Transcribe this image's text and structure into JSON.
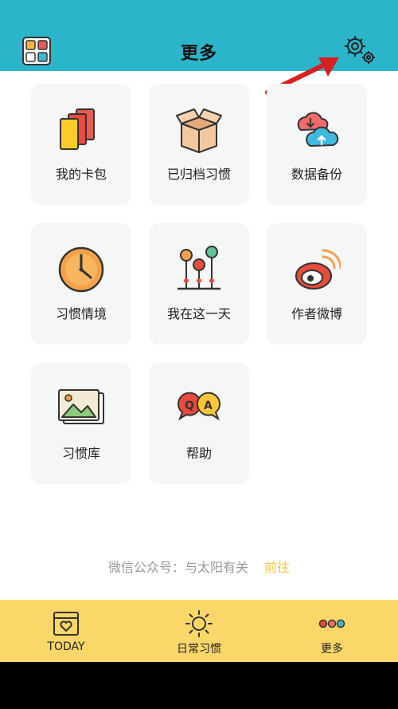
{
  "header": {
    "title": "更多"
  },
  "cards": [
    {
      "label": "我的卡包",
      "icon": "cards-icon"
    },
    {
      "label": "已归档习惯",
      "icon": "archive-box-icon"
    },
    {
      "label": "数据备份",
      "icon": "cloud-sync-icon"
    },
    {
      "label": "习惯情境",
      "icon": "clock-icon"
    },
    {
      "label": "我在这一天",
      "icon": "timeline-pins-icon"
    },
    {
      "label": "作者微博",
      "icon": "weibo-icon"
    },
    {
      "label": "习惯库",
      "icon": "picture-frame-icon"
    },
    {
      "label": "帮助",
      "icon": "qa-bubbles-icon"
    }
  ],
  "wechat": {
    "text": "微信公众号：与太阳有关",
    "action": "前往"
  },
  "bottom_nav": [
    {
      "label": "TODAY",
      "icon": "calendar-heart-icon"
    },
    {
      "label": "日常习惯",
      "icon": "sun-icon"
    },
    {
      "label": "更多",
      "icon": "three-dots-icon"
    }
  ],
  "colors": {
    "header": "#2bb5ca",
    "bottom_nav": "#fbd769",
    "card_bg": "#f5f6f6",
    "accent_link": "#f0c64c",
    "arrow": "#d82020"
  }
}
